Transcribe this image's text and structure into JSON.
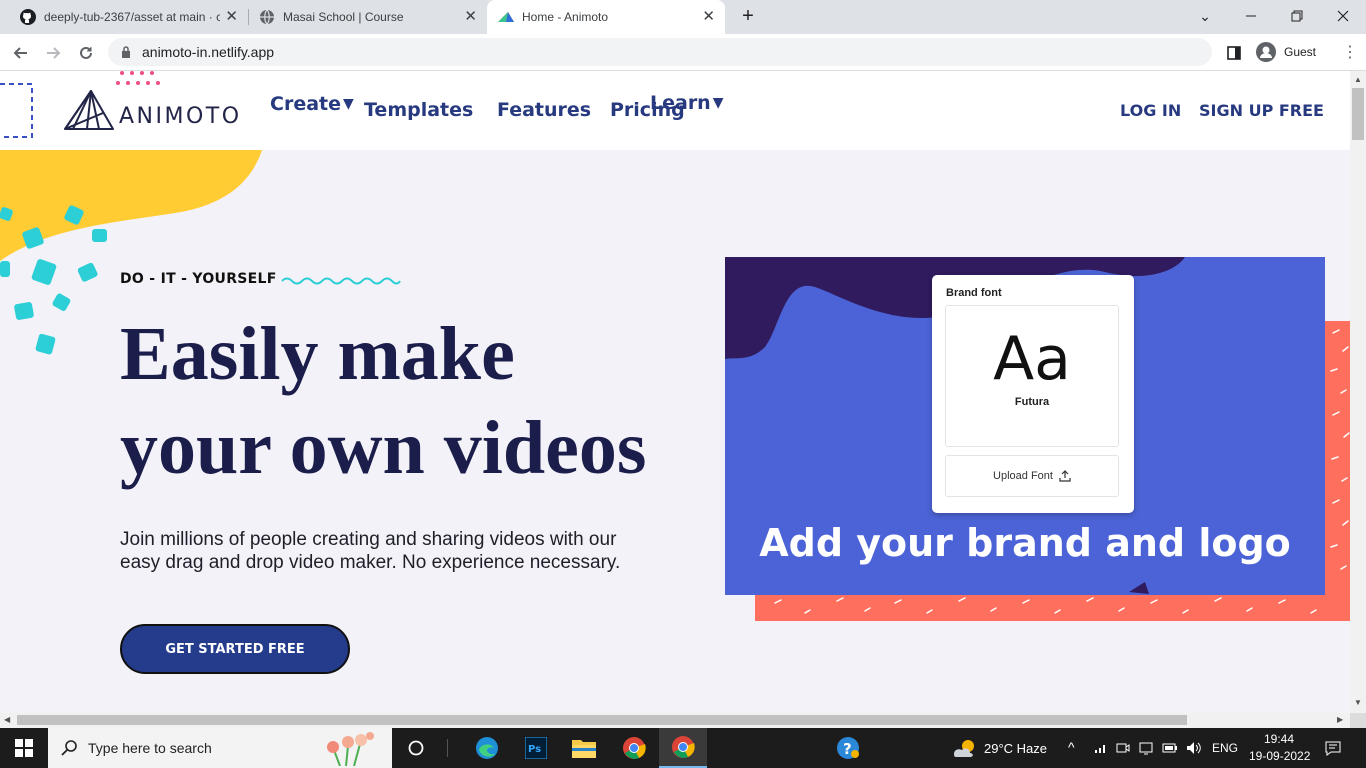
{
  "browser": {
    "tabs": [
      {
        "title": "deeply-tub-2367/asset at main · c",
        "active": false,
        "icon": "github-icon"
      },
      {
        "title": "Masai School | Course",
        "active": false,
        "icon": "globe-icon"
      },
      {
        "title": "Home - Animoto",
        "active": true,
        "icon": "animoto-favicon-icon"
      }
    ],
    "url": "animoto-in.netlify.app",
    "profile_label": "Guest"
  },
  "site": {
    "logo_text": "ANIMOTO",
    "nav": {
      "create": "Create",
      "templates": "Templates",
      "features": "Features",
      "pricing": "Pricing",
      "learn": "Learn"
    },
    "auth": {
      "login": "LOG IN",
      "signup": "SIGN UP FREE"
    },
    "hero": {
      "eyebrow": "DO - IT - YOURSELF",
      "headline_line1": "Easily make",
      "headline_line2": "your own videos",
      "subtext_line1": "Join millions of people creating and sharing videos with our",
      "subtext_line2": "easy drag and drop video maker. No experience necessary.",
      "cta": "GET STARTED FREE"
    },
    "card": {
      "panel_title": "Brand font",
      "font_sample": "Aa",
      "font_name": "Futura",
      "upload_label": "Upload Font",
      "caption": "Add your brand and logo"
    },
    "colors": {
      "nav_text": "#27397f",
      "headline": "#1b1d4a",
      "cta_bg": "#253b8c",
      "card_bg": "#4b63d6",
      "card_dark": "#2f1b5e",
      "coral": "#ff6f5e",
      "yellow": "#ffcc33",
      "teal": "#2ccfd6",
      "pink": "#ef4f86"
    }
  },
  "taskbar": {
    "search_placeholder": "Type here to search",
    "weather": "29°C  Haze",
    "language": "ENG",
    "time": "19:44",
    "date": "19-09-2022"
  }
}
